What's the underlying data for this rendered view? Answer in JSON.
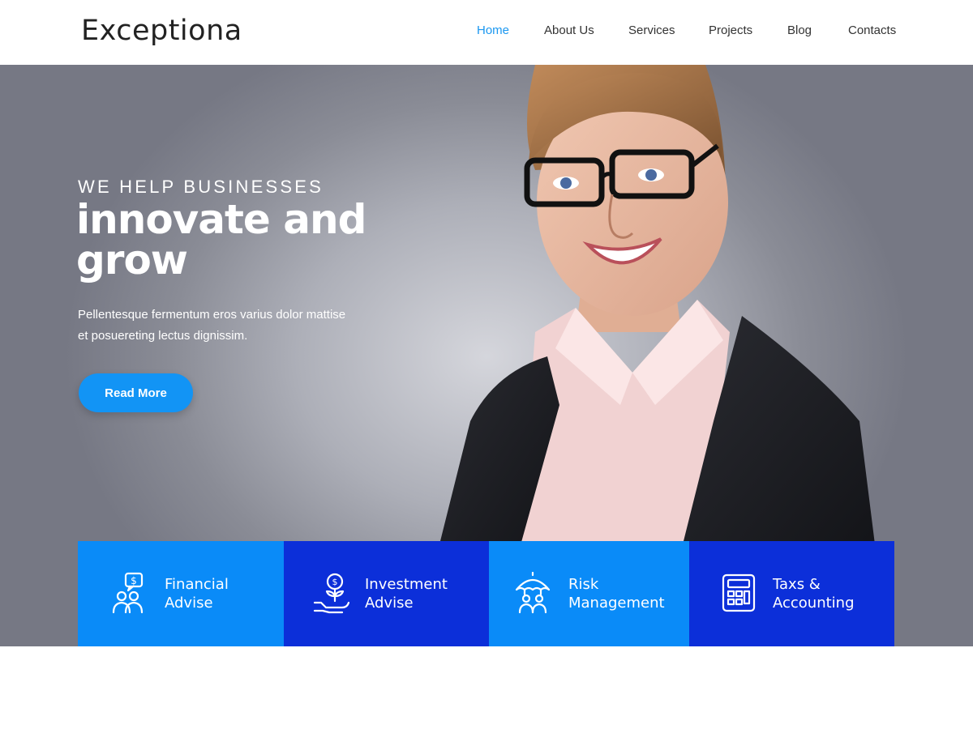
{
  "site": {
    "logo": "Exceptiona"
  },
  "nav": {
    "items": [
      {
        "label": "Home",
        "active": true
      },
      {
        "label": "About Us"
      },
      {
        "label": "Services"
      },
      {
        "label": "Projects"
      },
      {
        "label": "Blog"
      },
      {
        "label": "Contacts"
      }
    ],
    "active_color": "#1a97f0"
  },
  "hero": {
    "eyebrow": "WE HELP BUSINESSES",
    "title_line1": "innovate and",
    "title_line2": "grow",
    "text_line1": "Pellentesque fermentum eros varius dolor mattise",
    "text_line2": "et posuereting lectus dignissim.",
    "button_label": "Read More",
    "button_color": "#1294f5"
  },
  "services": [
    {
      "line1": "Financial",
      "line2": "Advise",
      "icon": "financial-advise-icon",
      "color": "#0a8bf8"
    },
    {
      "line1": "Investment",
      "line2": "Advise",
      "icon": "investment-advise-icon",
      "color": "#0c2fd9"
    },
    {
      "line1": "Risk",
      "line2": "Management",
      "icon": "risk-management-icon",
      "color": "#0a8bf8"
    },
    {
      "line1": "Taxs &",
      "line2": "Accounting",
      "icon": "calculator-icon",
      "color": "#0c2fd9"
    }
  ]
}
